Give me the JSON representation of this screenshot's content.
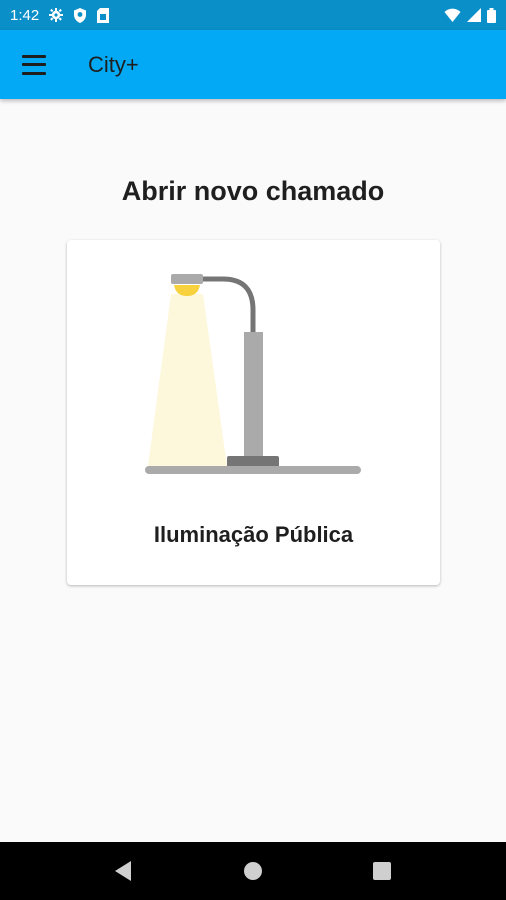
{
  "status_bar": {
    "time": "1:42",
    "icons": [
      "settings-icon",
      "shield-icon",
      "sim-card-icon",
      "wifi-icon",
      "signal-icon",
      "battery-icon"
    ]
  },
  "app_bar": {
    "title": "City+",
    "menu_icon": "hamburger-menu-icon"
  },
  "main": {
    "heading": "Abrir novo chamado",
    "cards": [
      {
        "label": "Iluminação Pública",
        "icon": "street-lamp-icon"
      }
    ]
  },
  "nav_bar": {
    "buttons": [
      "back-icon",
      "home-icon",
      "recents-icon"
    ]
  },
  "colors": {
    "status_bar": "#0a8fc8",
    "app_bar": "#03a9f4",
    "background": "#fafafa",
    "card": "#ffffff",
    "nav_bar": "#000000",
    "lamp_light": "#f7d23e",
    "lamp_beam": "#fdf8dc",
    "lamp_pole": "#aaaaaa",
    "lamp_dark": "#757575"
  }
}
